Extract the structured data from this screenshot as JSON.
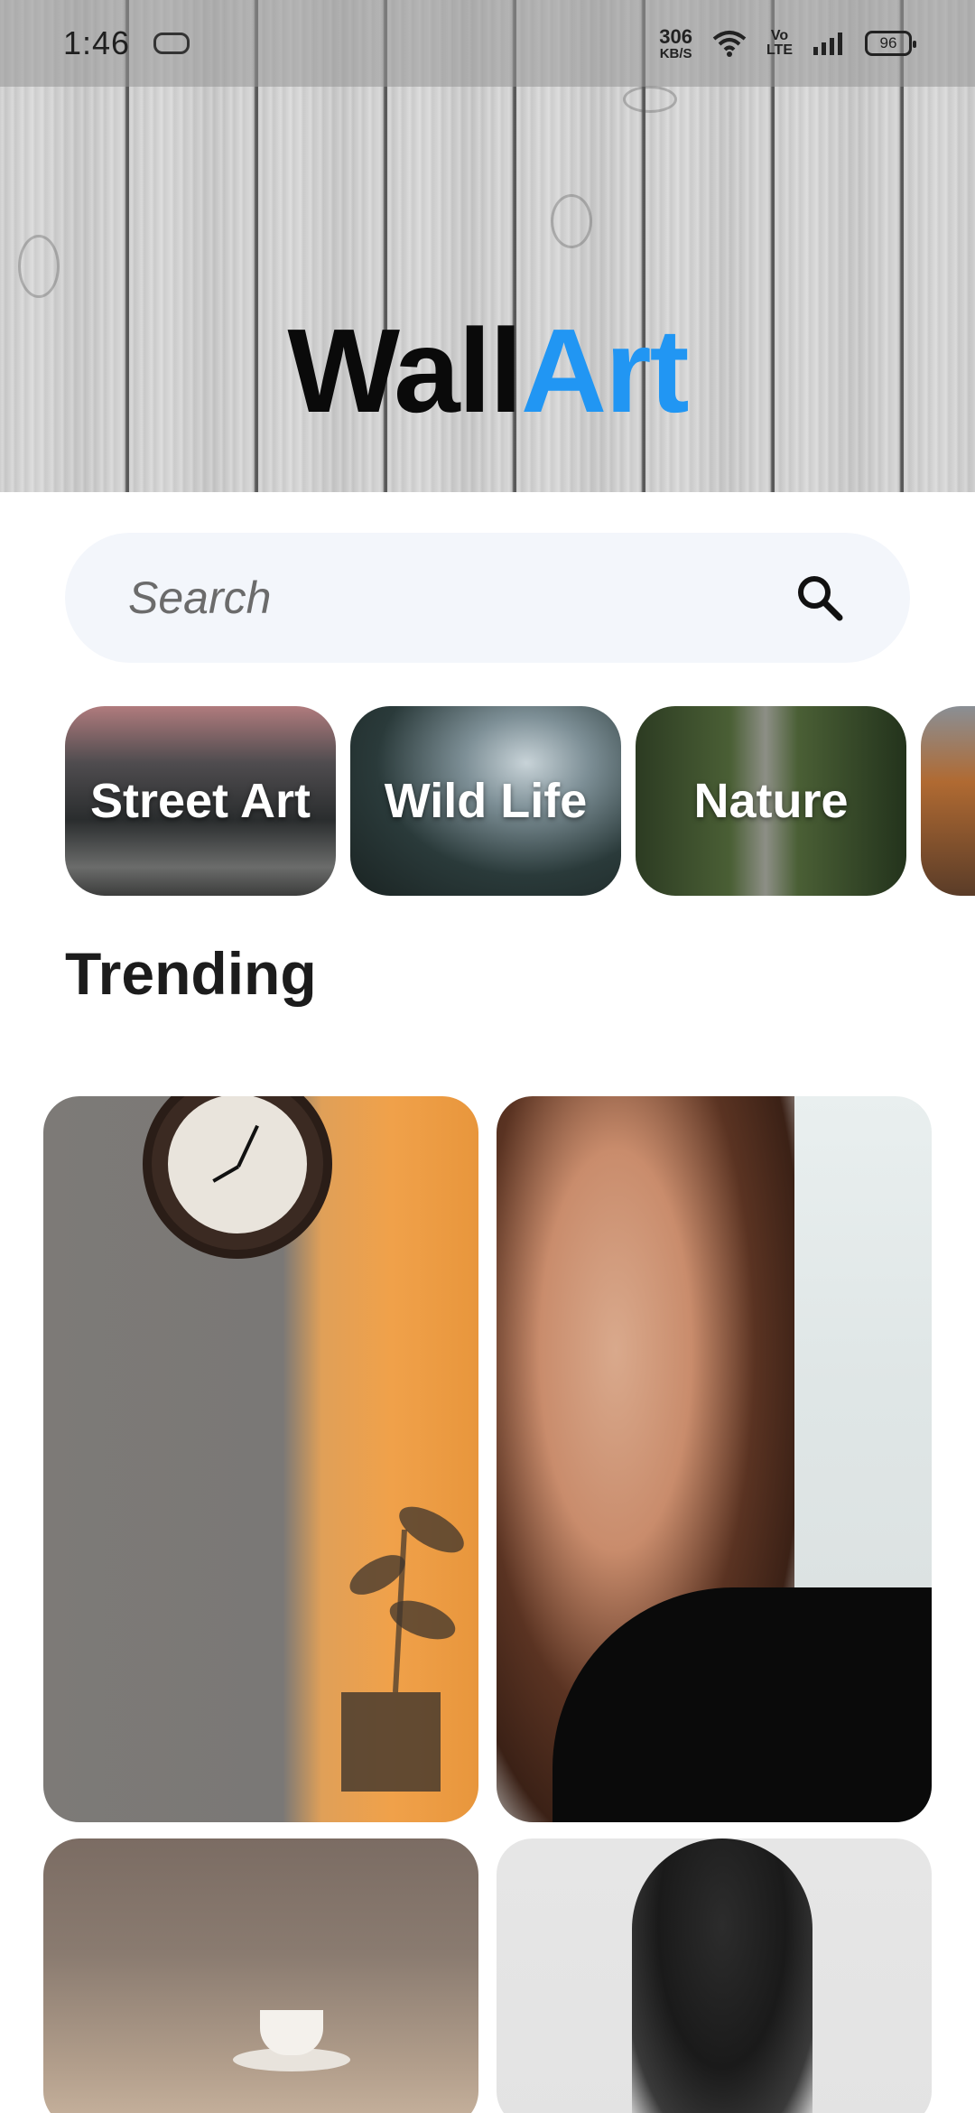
{
  "status_bar": {
    "time": "1:46",
    "speed_value": "306",
    "speed_unit": "KB/S",
    "network_label": "Vo\nLTE",
    "battery": "96"
  },
  "app": {
    "logo_part1": "Wall",
    "logo_part2": "Art",
    "logo_color_primary": "#0a0a0a",
    "logo_color_accent": "#2196f3"
  },
  "search": {
    "placeholder": "Search",
    "value": ""
  },
  "categories": [
    {
      "label": "Street Art"
    },
    {
      "label": "Wild Life"
    },
    {
      "label": "Nature"
    },
    {
      "label": ""
    }
  ],
  "trending": {
    "title": "Trending"
  }
}
